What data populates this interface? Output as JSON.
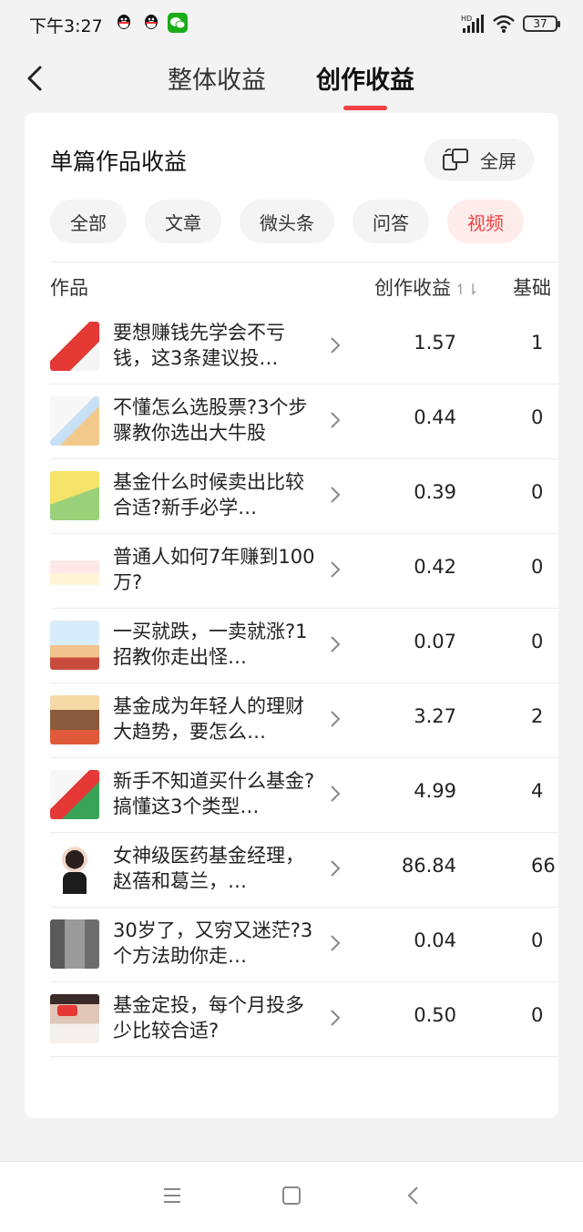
{
  "status_bar": {
    "time": "下午3:27",
    "battery": "37",
    "network": "HD"
  },
  "header": {
    "tabs": [
      {
        "label": "整体收益"
      },
      {
        "label": "创作收益"
      }
    ],
    "active_tab": 1
  },
  "card": {
    "title": "单篇作品收益",
    "fullscreen_label": "全屏",
    "filters": [
      "全部",
      "文章",
      "微头条",
      "问答",
      "视频"
    ],
    "active_filter": "视频",
    "columns": {
      "work": "作品",
      "creative": "创作收益",
      "base": "基础"
    },
    "sort_icon": "↿⇂",
    "rows": [
      {
        "title": "要想赚钱先学会不亏钱，这3条建议投…",
        "value": "1.57",
        "base": "1"
      },
      {
        "title": "不懂怎么选股票?3个步骤教你选出大牛股",
        "value": "0.44",
        "base": "0"
      },
      {
        "title": "基金什么时候卖出比较合适?新手必学…",
        "value": "0.39",
        "base": "0"
      },
      {
        "title": "普通人如何7年赚到100万?",
        "value": "0.42",
        "base": "0"
      },
      {
        "title": "一买就跌，一卖就涨?1招教你走出怪…",
        "value": "0.07",
        "base": "0"
      },
      {
        "title": "基金成为年轻人的理财大趋势，要怎么…",
        "value": "3.27",
        "base": "2"
      },
      {
        "title": "新手不知道买什么基金?搞懂这3个类型…",
        "value": "4.99",
        "base": "4"
      },
      {
        "title": "女神级医药基金经理，赵蓓和葛兰，…",
        "value": "86.84",
        "base": "66"
      },
      {
        "title": "30岁了，又穷又迷茫?3个方法助你走…",
        "value": "0.04",
        "base": "0"
      },
      {
        "title": "基金定投，每个月投多少比较合适?",
        "value": "0.50",
        "base": "0"
      }
    ]
  },
  "colors": {
    "accent": "#f04142",
    "chip_active_bg": "#feeceb",
    "card_bg": "#ffffff",
    "page_bg": "#f3f3f3"
  }
}
